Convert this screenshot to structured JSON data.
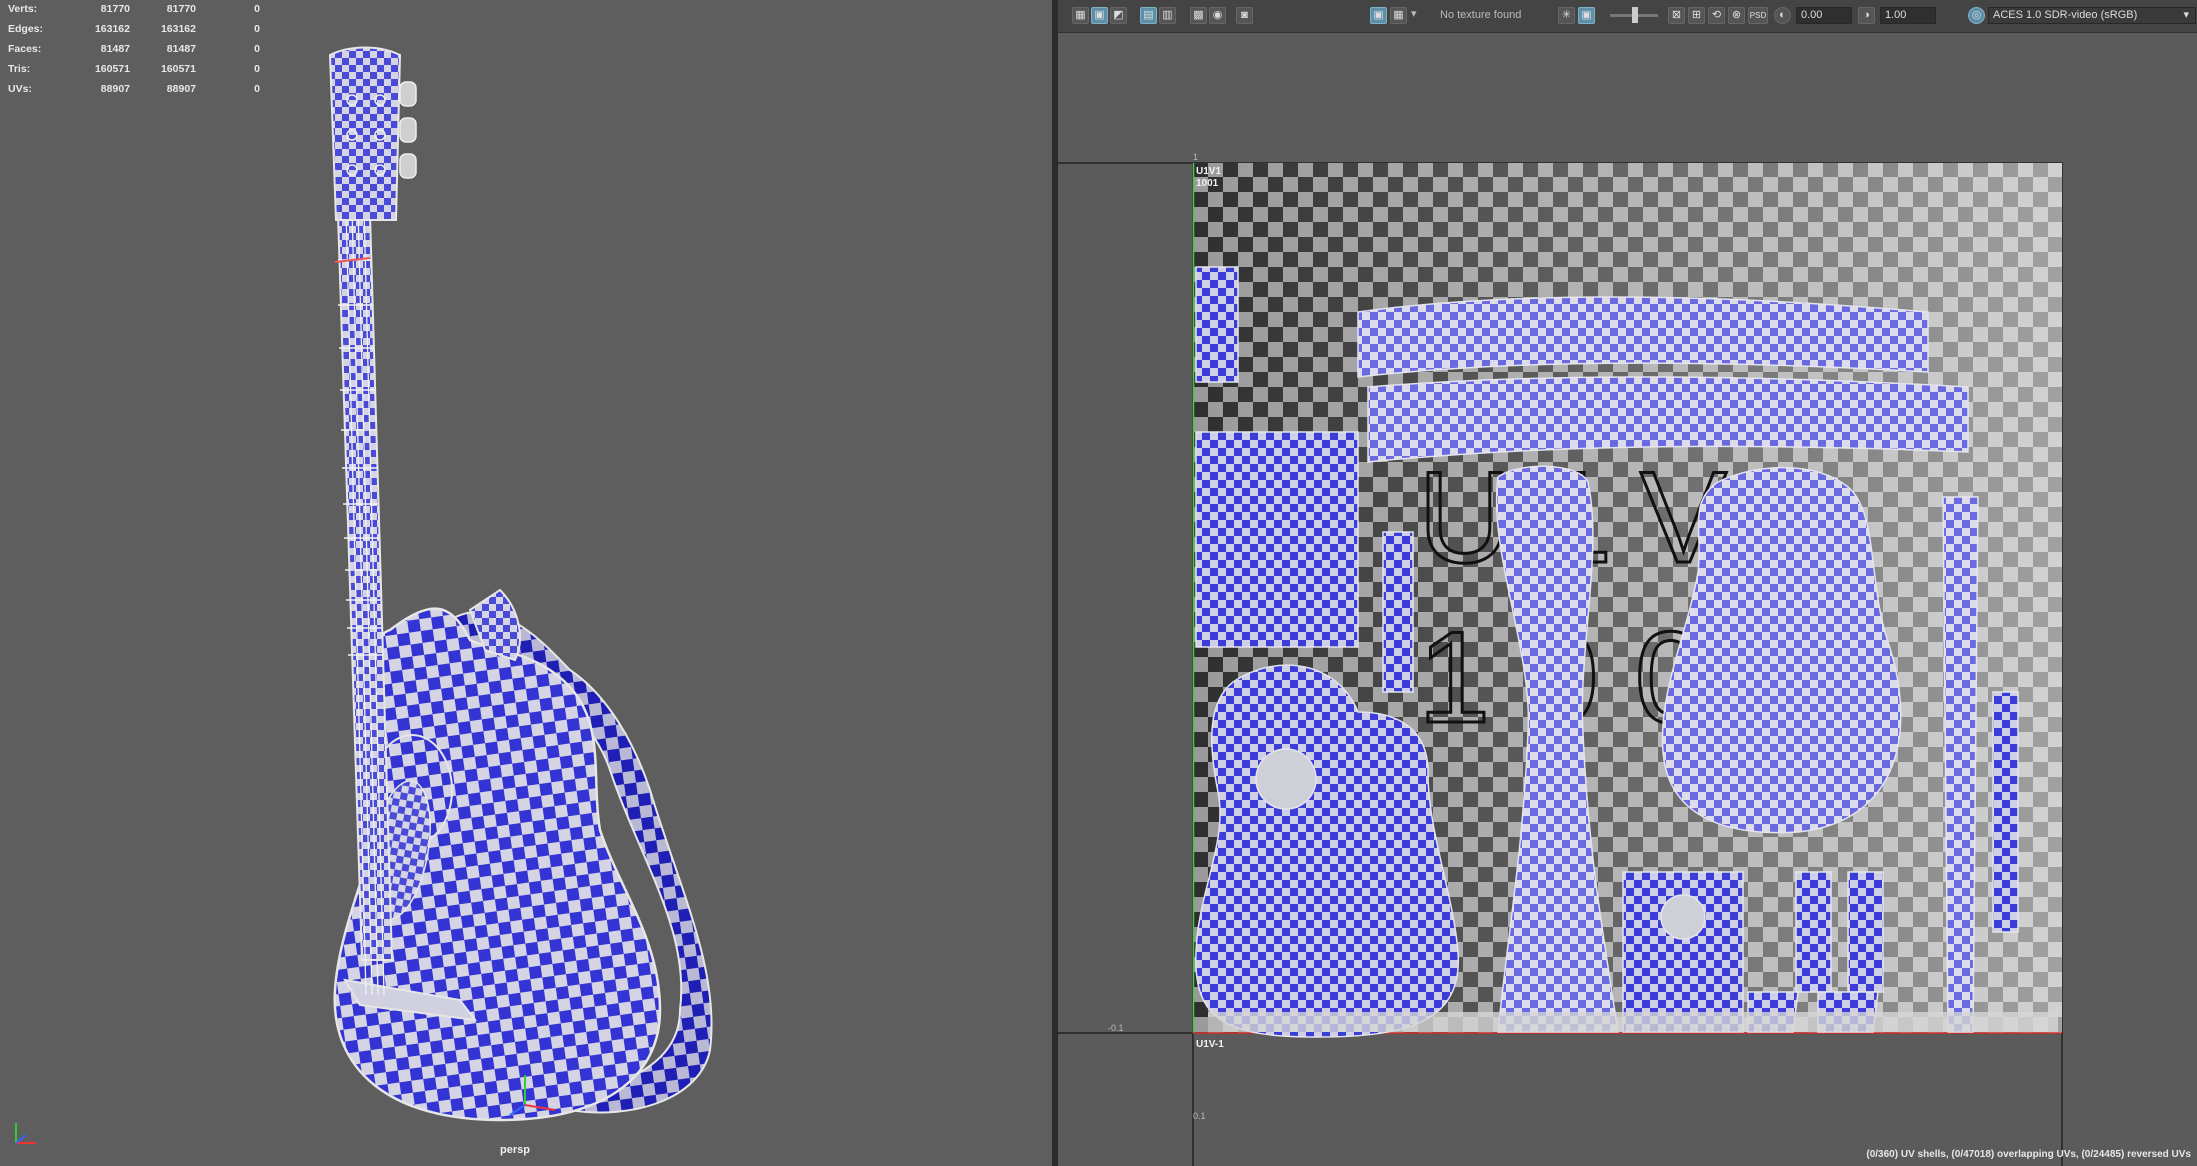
{
  "viewport": {
    "camera": "persp",
    "hud": [
      {
        "label": "Verts:",
        "a": "81770",
        "b": "81770",
        "c": "0"
      },
      {
        "label": "Edges:",
        "a": "163162",
        "b": "163162",
        "c": "0"
      },
      {
        "label": "Faces:",
        "a": "81487",
        "b": "81487",
        "c": "0"
      },
      {
        "label": "Tris:",
        "a": "160571",
        "b": "160571",
        "c": "0"
      },
      {
        "label": "UVs:",
        "a": "88907",
        "b": "88907",
        "c": "0"
      }
    ]
  },
  "uv_editor": {
    "toolbar": {
      "texture_status": "No texture found",
      "exposure_value": "0.00",
      "gamma_value": "1.00",
      "color_space": "ACES 1.0 SDR-video (sRGB)",
      "icons": [
        "grid-view-icon",
        "uv-image-icon",
        "shaded-uv-icon",
        "isolate-icon",
        "snap-grid-icon",
        "pixel-snap-icon",
        "tile-grid-icon",
        "texture-bake-icon",
        "checker-toggle-icon",
        "checker-map-icon",
        "dropdown-arrow-icon",
        "texture-borders-icon",
        "image-display-icon",
        "rgb-channels-icon",
        "distortion-icon",
        "uv-ratio-icon",
        "filter-icon",
        "psd-icon",
        "exposure-icon",
        "gamma-icon",
        "color-management-icon"
      ]
    },
    "tile_labels": {
      "main": "U1V1",
      "main_id": "1001",
      "below": "U1V-1",
      "big_label_line1": "U1V1",
      "big_label_line2": "1001"
    },
    "axis_labels": {
      "origin": "0.1",
      "left_tick": "-0.1",
      "top_tick": "1",
      "bottom_tick": "0.1"
    },
    "status": "(0/360) UV shells, (0/47018) overlapping UVs, (0/24485) reversed UVs"
  },
  "colors": {
    "checker_blue": "#3535d8",
    "checker_white": "#d8d8e8",
    "wire": "#e6e6e6",
    "viewport_bg": "#5e5e5e"
  }
}
